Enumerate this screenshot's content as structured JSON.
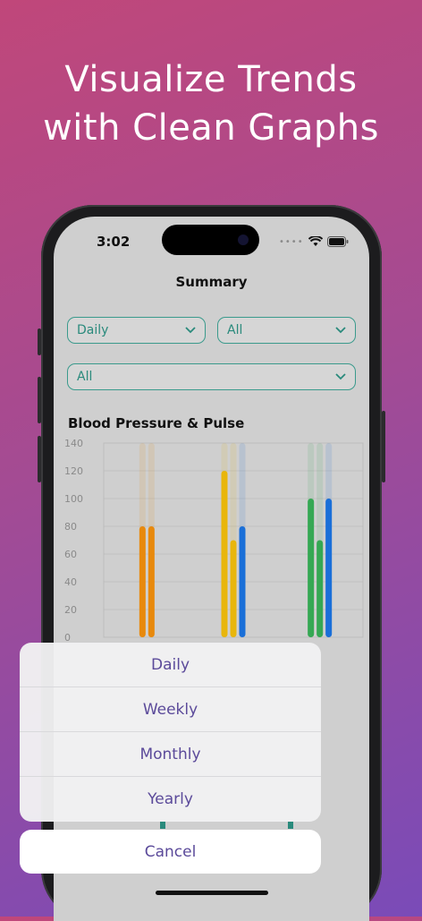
{
  "headline": {
    "line1": "Visualize Trends",
    "line2": "with Clean Graphs"
  },
  "status_bar": {
    "time": "3:02",
    "icons": [
      "signal-dots-icon",
      "wifi-icon",
      "battery-icon"
    ]
  },
  "nav": {
    "title": "Summary"
  },
  "filters": {
    "period": "Daily",
    "type": "All",
    "category": "All"
  },
  "chart_title": "Blood Pressure & Pulse",
  "chart_data": {
    "type": "bar",
    "ylim": [
      0,
      140
    ],
    "yticks": [
      0,
      20,
      40,
      60,
      80,
      100,
      120,
      140
    ],
    "grid": true,
    "groups": [
      {
        "series": [
          {
            "value": 80,
            "color": "#e8890c"
          },
          {
            "value": 80,
            "color": "#e8890c"
          }
        ]
      },
      {
        "series": [
          {
            "value": 120,
            "color": "#e8b60c"
          },
          {
            "value": 70,
            "color": "#e8b60c"
          },
          {
            "value": 80,
            "color": "#1a6fd8"
          }
        ]
      },
      {
        "series": [
          {
            "value": 100,
            "color": "#35a853"
          },
          {
            "value": 70,
            "color": "#35a853"
          },
          {
            "value": 100,
            "color": "#1a6fd8"
          }
        ]
      }
    ]
  },
  "action_sheet": {
    "options": [
      "Daily",
      "Weekly",
      "Monthly",
      "Yearly"
    ],
    "cancel": "Cancel"
  },
  "colors": {
    "accent": "#2a8a7c",
    "sheet_text": "#5b4a9a"
  }
}
